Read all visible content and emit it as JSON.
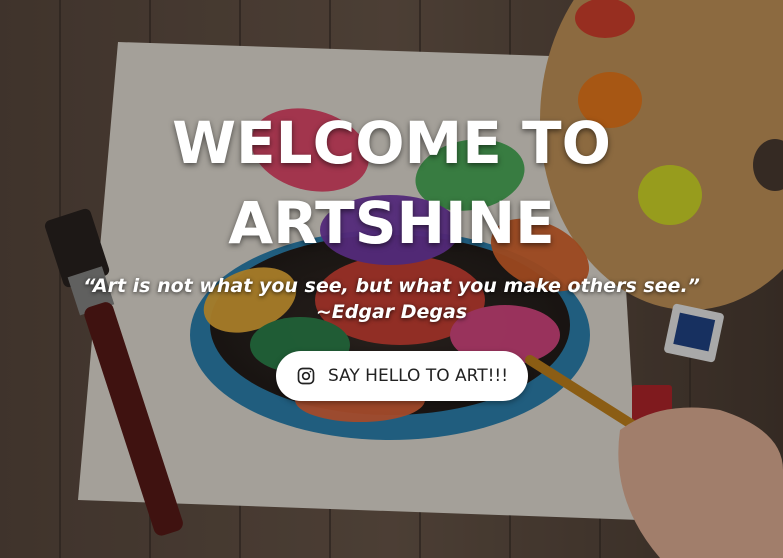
{
  "hero": {
    "title_line1": "WELCOME TO",
    "title_line2": "ARTSHINE",
    "quote_text": "“Art is not what you see, but what you make others see.”",
    "quote_author": "~Edgar Degas",
    "cta_label": "SAY HELLO TO ART!!!",
    "cta_icon": "instagram-icon"
  },
  "colors": {
    "overlay": "rgba(0,0,0,0.30)",
    "text": "#ffffff",
    "button_bg": "#ffffff",
    "button_text": "#222222"
  }
}
